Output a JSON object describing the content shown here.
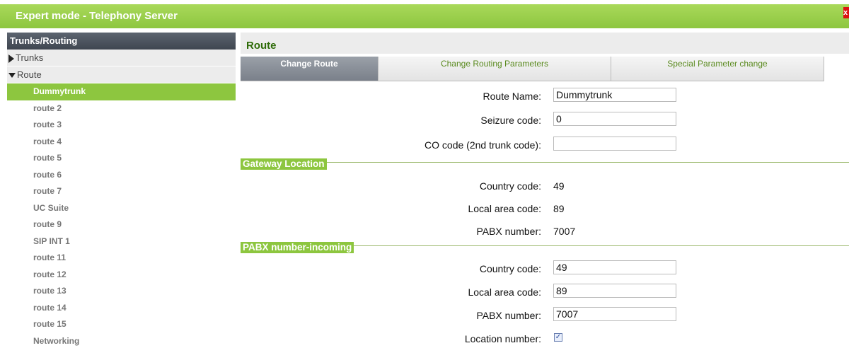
{
  "window": {
    "title": "Expert mode - Telephony Server",
    "close": "x"
  },
  "sidebar": {
    "header": "Trunks/Routing",
    "groups": {
      "trunks": "Trunks",
      "route": "Route"
    },
    "items": [
      "Dummytrunk",
      "route 2",
      "route 3",
      "route 4",
      "route 5",
      "route 6",
      "route 7",
      "UC Suite",
      "route 9",
      "SIP INT 1",
      "route 11",
      "route 12",
      "route 13",
      "route 14",
      "route 15",
      "Networking"
    ],
    "active_index": 0
  },
  "main": {
    "heading": "Route",
    "tabs": [
      "Change Route",
      "Change Routing Parameters",
      "Special Parameter change"
    ],
    "route_name_label": "Route Name:",
    "route_name": "Dummytrunk",
    "seizure_code_label": "Seizure code:",
    "seizure_code": "0",
    "co_code_label": "CO code (2nd trunk code):",
    "co_code": "",
    "gateway": {
      "title": "Gateway Location",
      "country_code_label": "Country code:",
      "country_code": "49",
      "local_area_code_label": "Local area code:",
      "local_area_code": "89",
      "pabx_number_label": "PABX number:",
      "pabx_number": "7007"
    },
    "pabx_incoming": {
      "title": "PABX number-incoming",
      "country_code_label": "Country code:",
      "country_code": "49",
      "local_area_code_label": "Local area code:",
      "local_area_code": "89",
      "pabx_number_label": "PABX number:",
      "pabx_number": "7007",
      "location_number_label": "Location number:",
      "location_number_checked": true
    }
  }
}
